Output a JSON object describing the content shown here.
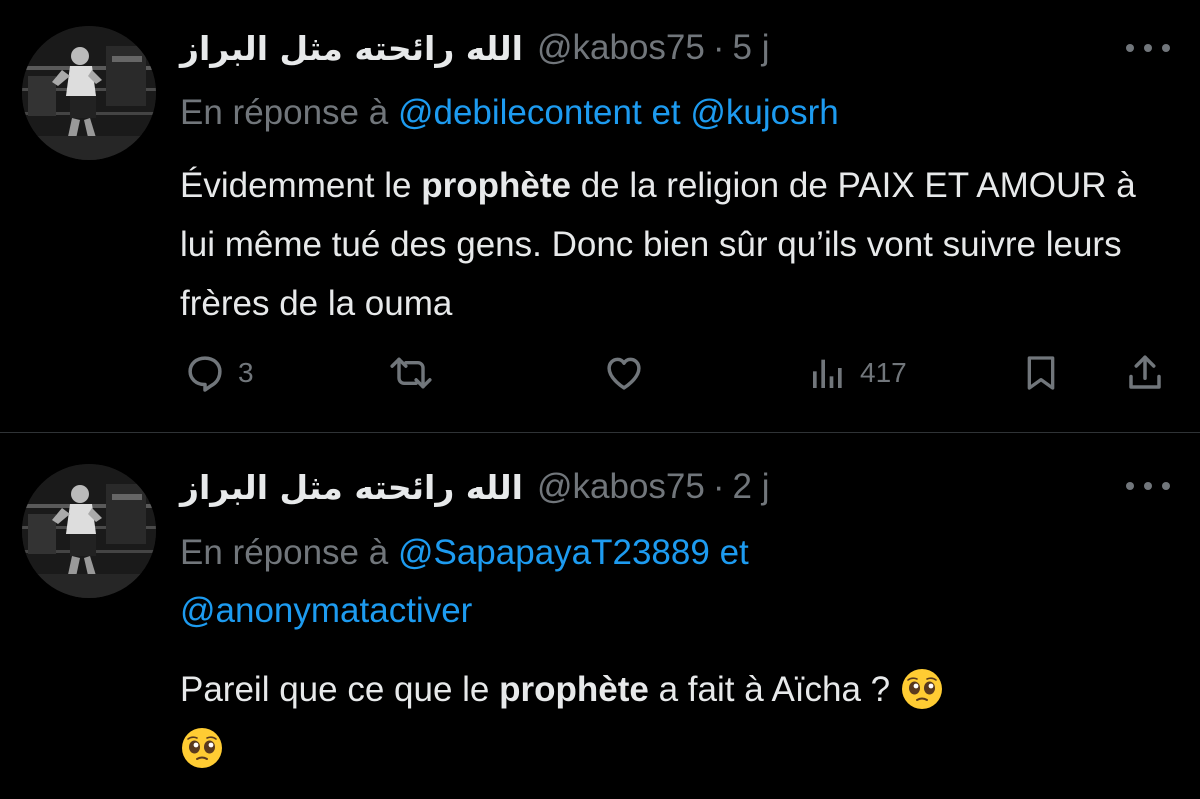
{
  "tweets": [
    {
      "display_name": "الله رائحته مثل البراز",
      "handle": "@kabos75",
      "separator": "·",
      "time": "5 j",
      "reply_prefix": "En réponse à",
      "mention_1": "@debilecontent",
      "reply_joiner": "et",
      "mention_2": "@kujosrh",
      "body_part1": "Évidemment le",
      "body_bold": "prophète",
      "body_part2": "de la religion de PAIX ET AMOUR à lui même tué des gens. Donc bien sûr qu’ils vont suivre leurs frères de la ouma",
      "reply_count": "3",
      "views_count": "417"
    },
    {
      "display_name": "الله رائحته مثل البراز",
      "handle": "@kabos75",
      "separator": "·",
      "time": "2 j",
      "reply_prefix": "En réponse à",
      "mention_1": "@SapapayaT23889",
      "reply_joiner": "et",
      "mention_2": "@anonymatactiver",
      "body_part1": "Pareil que ce que le",
      "body_bold": "prophète",
      "body_part2": "a fait à Aïcha ?"
    }
  ],
  "icons": {
    "reply": "speech-bubble-icon",
    "retweet": "retweet-arrows-icon",
    "like": "heart-icon",
    "views": "bar-chart-icon",
    "bookmark": "bookmark-icon",
    "share": "share-upload-icon",
    "more": "ellipsis-icon",
    "emoji": "pleading-face-emoji"
  },
  "colors": {
    "background": "#000000",
    "text": "#e7e9ea",
    "muted": "#71767b",
    "link": "#1d9bf0",
    "divider": "#2f3336"
  }
}
